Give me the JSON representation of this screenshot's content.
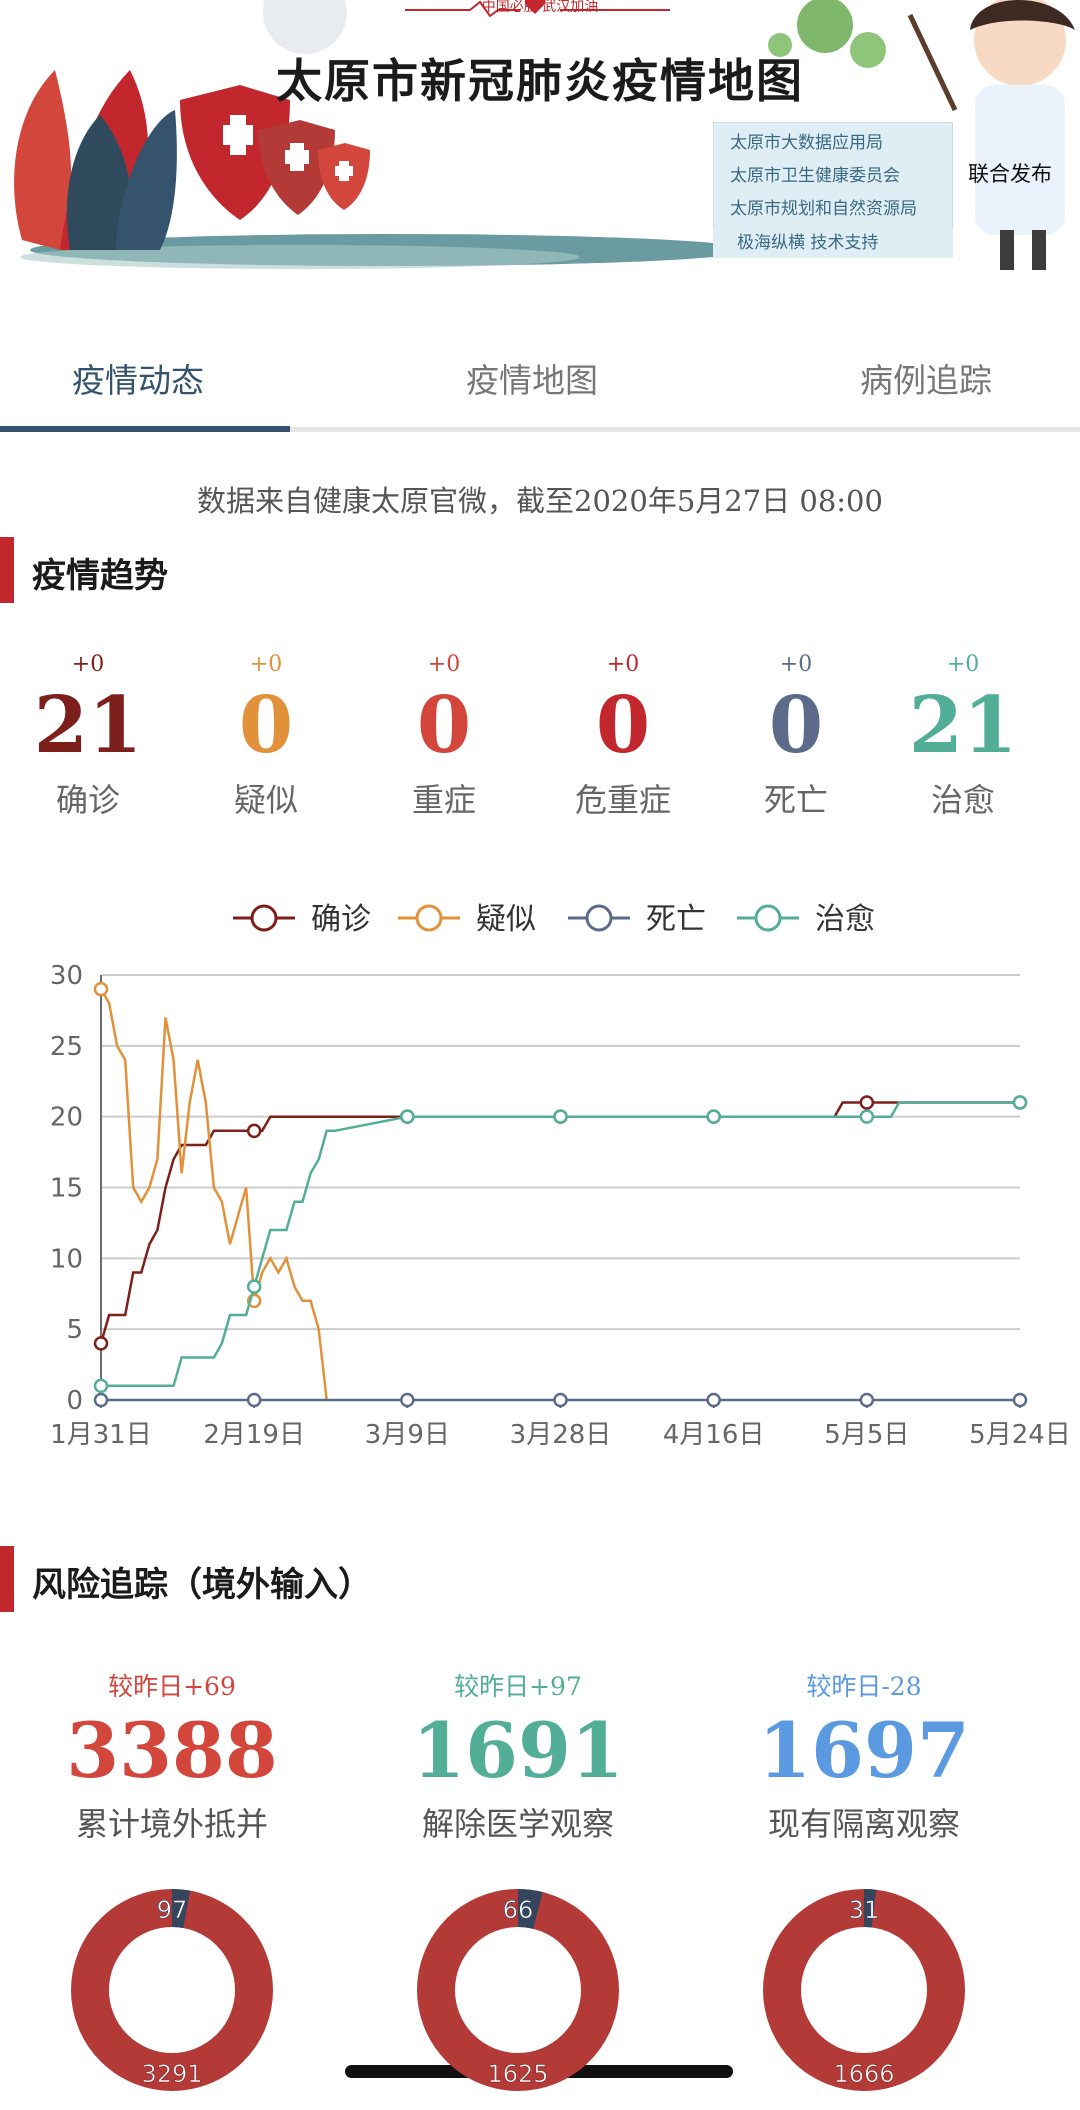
{
  "banner": {
    "title": "太原市新冠肺炎疫情地图",
    "slogan": "中国必胜  武汉加油",
    "publishers": [
      "太原市大数据应用局",
      "太原市卫生健康委员会",
      "太原市规划和自然资源局"
    ],
    "joint": "联合发布",
    "support": "极海纵横 技术支持"
  },
  "tabs": [
    {
      "label": "疫情动态",
      "active": true
    },
    {
      "label": "疫情地图",
      "active": false
    },
    {
      "label": "病例追踪",
      "active": false
    }
  ],
  "source": "数据来自健康太原官微，截至2020年5月27日 08:00",
  "trend": {
    "title": "疫情趋势",
    "stats": [
      {
        "delta": "+0",
        "value": "21",
        "label": "确诊",
        "color": "#7d1f1a"
      },
      {
        "delta": "+0",
        "value": "0",
        "label": "疑似",
        "color": "#e0913a"
      },
      {
        "delta": "+0",
        "value": "0",
        "label": "重症",
        "color": "#d2463c"
      },
      {
        "delta": "+0",
        "value": "0",
        "label": "危重症",
        "color": "#c1272d"
      },
      {
        "delta": "+0",
        "value": "0",
        "label": "死亡",
        "color": "#5d6b8a"
      },
      {
        "delta": "+0",
        "value": "21",
        "label": "治愈",
        "color": "#53ae98"
      }
    ]
  },
  "chart_data": {
    "type": "line",
    "x": [
      "2020-01-31",
      "2020-02-01",
      "2020-02-02",
      "2020-02-03",
      "2020-02-04",
      "2020-02-05",
      "2020-02-06",
      "2020-02-07",
      "2020-02-08",
      "2020-02-09",
      "2020-02-10",
      "2020-02-11",
      "2020-02-12",
      "2020-02-13",
      "2020-02-14",
      "2020-02-15",
      "2020-02-16",
      "2020-02-17",
      "2020-02-18",
      "2020-02-19",
      "2020-02-20",
      "2020-02-21",
      "2020-02-22",
      "2020-02-23",
      "2020-02-24",
      "2020-02-25",
      "2020-02-26",
      "2020-02-27",
      "2020-02-28",
      "2020-02-29",
      "2020-03-09",
      "2020-03-28",
      "2020-04-16",
      "2020-05-01",
      "2020-05-02",
      "2020-05-05",
      "2020-05-08",
      "2020-05-09",
      "2020-05-24"
    ],
    "series": [
      {
        "name": "确诊",
        "color": "#7d1f1a",
        "values": [
          4,
          6,
          6,
          6,
          9,
          9,
          11,
          12,
          15,
          17,
          18,
          18,
          18,
          18,
          19,
          19,
          19,
          19,
          19,
          19,
          19,
          20,
          20,
          20,
          20,
          20,
          20,
          20,
          20,
          20,
          20,
          20,
          20,
          20,
          21,
          21,
          21,
          21,
          21
        ]
      },
      {
        "name": "疑似",
        "color": "#e0913a",
        "values": [
          29,
          28,
          25,
          24,
          15,
          14,
          15,
          17,
          27,
          24,
          16,
          21,
          24,
          21,
          15,
          14,
          11,
          13,
          15,
          7,
          9,
          10,
          9,
          10,
          8,
          7,
          7,
          5,
          0,
          null,
          null,
          null,
          null,
          null,
          null,
          null,
          null,
          null,
          null
        ]
      },
      {
        "name": "死亡",
        "color": "#5d6b8a",
        "values": [
          0,
          0,
          0,
          0,
          0,
          0,
          0,
          0,
          0,
          0,
          0,
          0,
          0,
          0,
          0,
          0,
          0,
          0,
          0,
          0,
          0,
          0,
          0,
          0,
          0,
          0,
          0,
          0,
          0,
          0,
          0,
          0,
          0,
          0,
          0,
          0,
          0,
          0,
          0
        ]
      },
      {
        "name": "治愈",
        "color": "#53ae98",
        "values": [
          1,
          1,
          1,
          1,
          1,
          1,
          1,
          1,
          1,
          1,
          3,
          3,
          3,
          3,
          3,
          4,
          6,
          6,
          6,
          8,
          10,
          12,
          12,
          12,
          14,
          14,
          16,
          17,
          19,
          19,
          20,
          20,
          20,
          20,
          20,
          20,
          20,
          21,
          21
        ]
      }
    ],
    "marker_dates": [
      "2020-01-31",
      "2020-02-19",
      "2020-03-09",
      "2020-03-28",
      "2020-04-16",
      "2020-05-05",
      "2020-05-24"
    ],
    "ytick_labels": [
      "0",
      "5",
      "10",
      "15",
      "20",
      "25",
      "30"
    ],
    "xtick_labels": [
      "1月31日",
      "2月19日",
      "3月9日",
      "3月28日",
      "4月16日",
      "5月5日",
      "5月24日"
    ],
    "ylim": [
      0,
      30
    ],
    "legend_position": "top-center",
    "grid": true
  },
  "risk": {
    "title": "风险追踪（境外输入）",
    "items": [
      {
        "delta": "较昨日+69",
        "value": "3388",
        "label": "累计境外抵并",
        "color": "#d2463c",
        "ring_small": "97",
        "ring_large": "3291"
      },
      {
        "delta": "较昨日+97",
        "value": "1691",
        "label": "解除医学观察",
        "color": "#53ae98",
        "ring_small": "66",
        "ring_large": "1625"
      },
      {
        "delta": "较昨日-28",
        "value": "1697",
        "label": "现有隔离观察",
        "color": "#5b9ae0",
        "ring_small": "31",
        "ring_large": "1666"
      }
    ],
    "ring_colors": {
      "large": "#b33a37",
      "small": "#35455e"
    }
  }
}
